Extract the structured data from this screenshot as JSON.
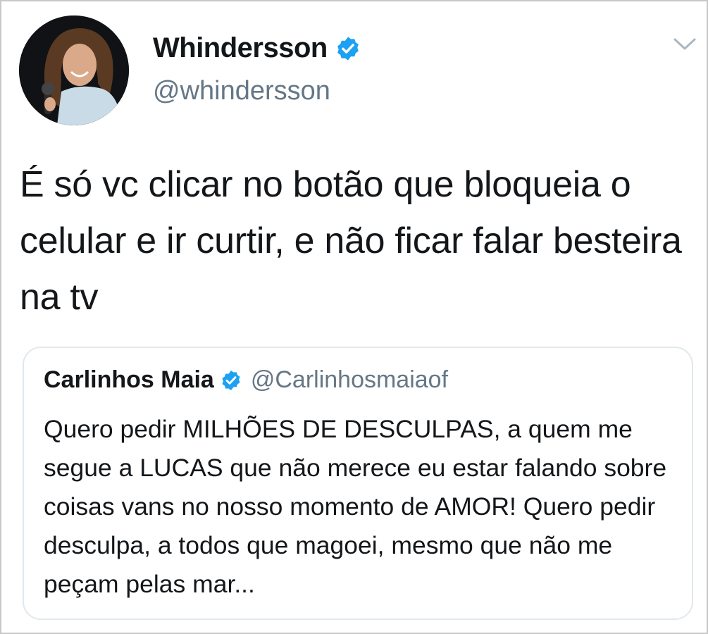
{
  "tweet": {
    "author_name": "Whindersson",
    "author_handle": "@whindersson",
    "verified": true,
    "text": "É só vc clicar no botão que bloqueia o celular e ir curtir, e não ficar falar besteira na tv"
  },
  "quoted_tweet": {
    "author_name": "Carlinhos Maia",
    "author_handle": "@Carlinhosmaiaof",
    "verified": true,
    "text": "Quero pedir MILHÕES DE DESCULPAS, a quem me segue a LUCAS que não merece eu estar falando sobre coisas vans no nosso momento de AMOR! Quero pedir desculpa, a todos que magoei, mesmo que não me peçam pelas mar..."
  },
  "icons": {
    "verified": "verified-badge-icon",
    "menu": "chevron-down-icon"
  },
  "colors": {
    "verified_blue": "#1da1f2",
    "handle_gray": "#657786",
    "text_dark": "#14171a",
    "quote_border": "#e1e8ed"
  }
}
